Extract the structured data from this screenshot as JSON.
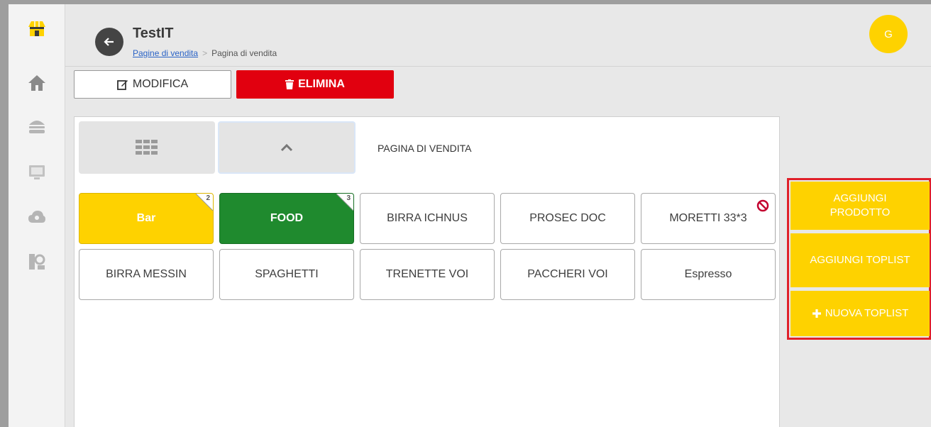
{
  "header": {
    "title": "TestIT",
    "breadcrumb": {
      "link": "Pagine di vendita",
      "current": "Pagina di vendita"
    },
    "avatar_initial": "G"
  },
  "toolbar": {
    "edit_label": "MODIFICA",
    "delete_label": "ELIMINA"
  },
  "panel": {
    "page_label": "PAGINA DI VENDITA"
  },
  "tiles": [
    {
      "label": "Bar",
      "badge": "2"
    },
    {
      "label": "FOOD",
      "badge": "3"
    },
    {
      "label": "BIRRA ICHNUS"
    },
    {
      "label": "PROSEC DOC"
    },
    {
      "label": "MORETTI 33*3"
    },
    {
      "label": "BIRRA MESSIN"
    },
    {
      "label": "SPAGHETTI"
    },
    {
      "label": "TRENETTE VOI"
    },
    {
      "label": "PACCHERI VOI"
    },
    {
      "label": "Espresso"
    }
  ],
  "actions": {
    "add_product": "AGGIUNGI PRODOTTO",
    "add_toplist": "AGGIUNGI TOPLIST",
    "new_toplist": "NUOVA TOPLIST"
  },
  "colors": {
    "accent_yellow": "#fed200",
    "danger_red": "#e1000f",
    "folder_green": "#1f8a2e"
  },
  "icons": {
    "sidebar": [
      "store-icon",
      "home-icon",
      "burger-icon",
      "pos-terminal-icon",
      "cloud-icon",
      "user-search-icon"
    ]
  }
}
